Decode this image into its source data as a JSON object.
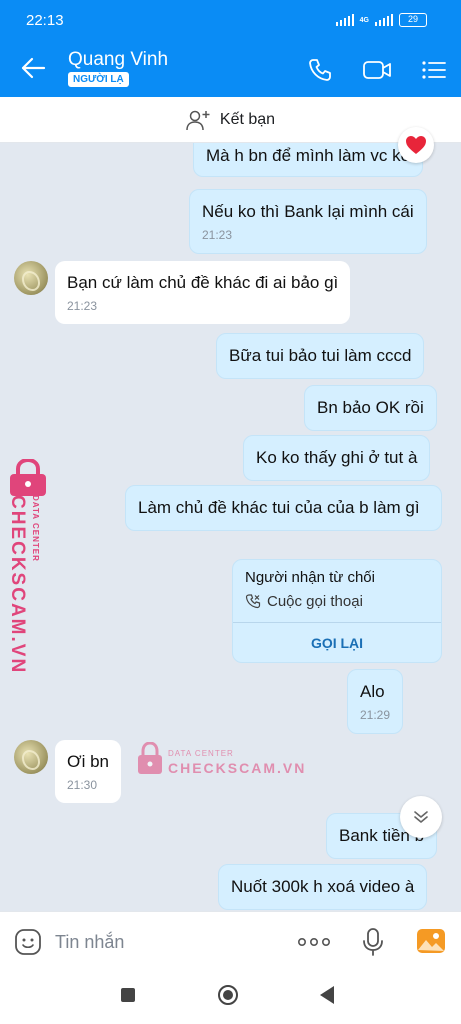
{
  "status_bar": {
    "time": "22:13",
    "network": "4G",
    "battery": "29"
  },
  "header": {
    "title": "Quang Vinh",
    "badge": "NGƯỜI LẠ"
  },
  "add_friend": {
    "label": "Kết bạn"
  },
  "messages": [
    {
      "text": "Mà h bn để mình làm vc ko",
      "time": ""
    },
    {
      "text": "Nếu ko thì Bank lại mình cái",
      "time": "21:23"
    },
    {
      "text": "Bạn cứ làm chủ đề khác đi ai bảo gì",
      "time": "21:23"
    },
    {
      "text": "Bữa tui bảo tui làm cccd",
      "time": ""
    },
    {
      "text": "Bn bảo OK rồi",
      "time": ""
    },
    {
      "text": "Ko ko thấy ghi ở tut à",
      "time": ""
    },
    {
      "text": "Làm chủ đề khác tui của của b làm gì",
      "time": ""
    },
    {
      "text": "Alo",
      "time": "21:29"
    },
    {
      "text": "Ơi bn",
      "time": "21:30"
    },
    {
      "text": "Bank tiền b",
      "time": ""
    },
    {
      "text": "Nuốt 300k h xoá video à",
      "time": ""
    }
  ],
  "call_card": {
    "title": "Người nhận từ chối",
    "subtitle": "Cuộc gọi thoại",
    "action": "GỌI LẠI"
  },
  "watermark": {
    "brand": "CHECKSCAM.VN",
    "tag": "DATA CENTER"
  },
  "composer": {
    "placeholder": "Tin nhắn"
  },
  "colors": {
    "header": "#0a8cf5",
    "outgoing": "#d5efff",
    "incoming": "#ffffff",
    "watermark": "#e0457b"
  },
  "icons": [
    "back-icon",
    "phone-icon",
    "video-icon",
    "menu-icon",
    "add-friend-icon",
    "heart-icon",
    "chevron-down-icon",
    "sticker-icon",
    "more-icon",
    "mic-icon",
    "image-icon"
  ]
}
